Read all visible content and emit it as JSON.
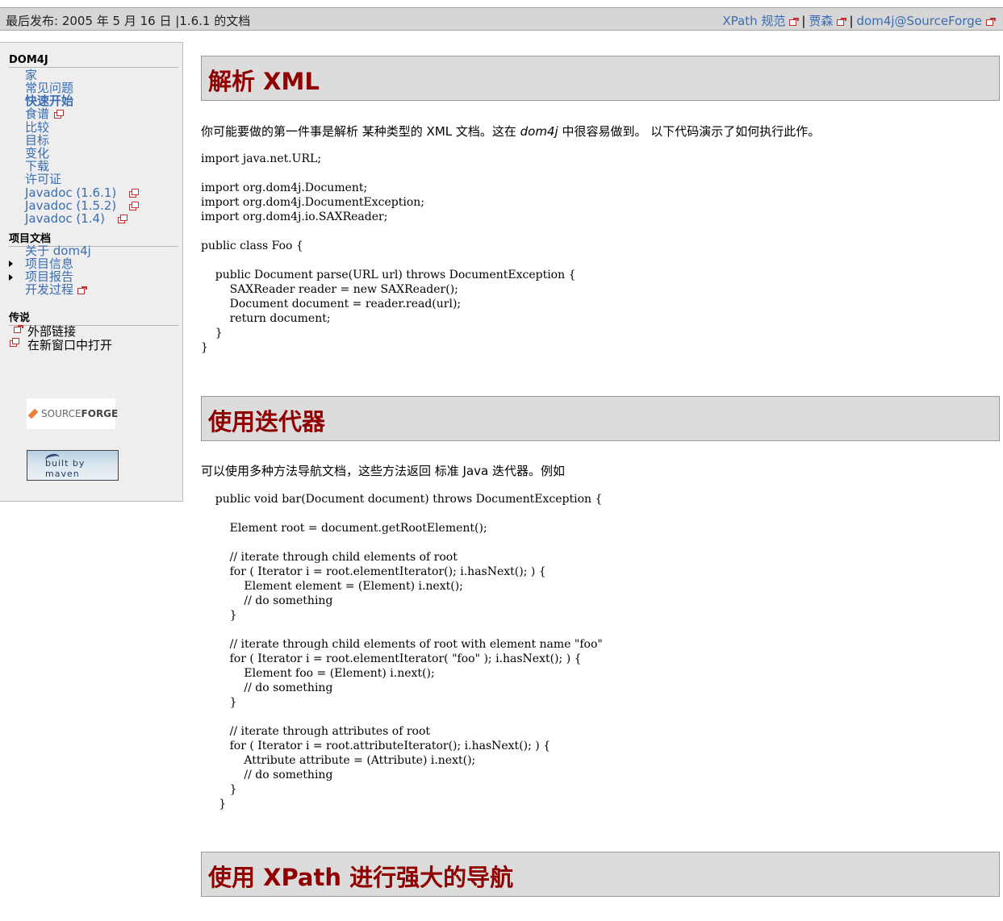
{
  "topbar": {
    "published_label": "最后发布:",
    "published_date": "2005 年 5 月 16 日 |1.6.1 的文档",
    "links": [
      "XPath 规范",
      "贾森",
      "dom4j@SourceForge"
    ]
  },
  "nav": {
    "section1": {
      "title": "DOM4J",
      "items": [
        "家",
        "常见问题",
        "快速开始",
        "食谱",
        "比较",
        "目标",
        "变化",
        "下载",
        "许可证",
        "Javadoc (1.6.1)",
        "Javadoc (1.5.2)",
        "Javadoc (1.4)"
      ]
    },
    "section2": {
      "title": "项目文档",
      "items": [
        "关于 dom4j",
        "项目信息",
        "项目报告",
        "开发过程"
      ]
    },
    "section3": {
      "title": "传说",
      "items": [
        "外部链接",
        "在新窗口中打开"
      ]
    },
    "sourceforge_logo": {
      "text_a": "SOURCE",
      "text_b": "FORGE"
    },
    "maven_logo": "built by maven"
  },
  "sections": [
    {
      "title": "解析 XML",
      "intro_a": "你可能要做的第一件事是解析 某种类型的 XML 文档。这在 ",
      "intro_em": "dom4j",
      "intro_b": " 中很容易做到。 以下代码演示了如何执行此作。",
      "code": "import java.net.URL;\n\nimport org.dom4j.Document;\nimport org.dom4j.DocumentException;\nimport org.dom4j.io.SAXReader;\n\npublic class Foo {\n\n    public Document parse(URL url) throws DocumentException {\n        SAXReader reader = new SAXReader();\n        Document document = reader.read(url);\n        return document;\n    }\n}"
    },
    {
      "title": "使用迭代器",
      "intro": "可以使用多种方法导航文档，这些方法返回 标准 Java 迭代器。例如",
      "code": "    public void bar(Document document) throws DocumentException {\n\n        Element root = document.getRootElement();\n\n        // iterate through child elements of root\n        for ( Iterator i = root.elementIterator(); i.hasNext(); ) {\n            Element element = (Element) i.next();\n            // do something\n        }\n\n        // iterate through child elements of root with element name \"foo\"\n        for ( Iterator i = root.elementIterator( \"foo\" ); i.hasNext(); ) {\n            Element foo = (Element) i.next();\n            // do something\n        }\n\n        // iterate through attributes of root\n        for ( Iterator i = root.attributeIterator(); i.hasNext(); ) {\n            Attribute attribute = (Attribute) i.next();\n            // do something\n        }\n     }"
    },
    {
      "title": "使用 XPath 进行强大的导航"
    }
  ]
}
